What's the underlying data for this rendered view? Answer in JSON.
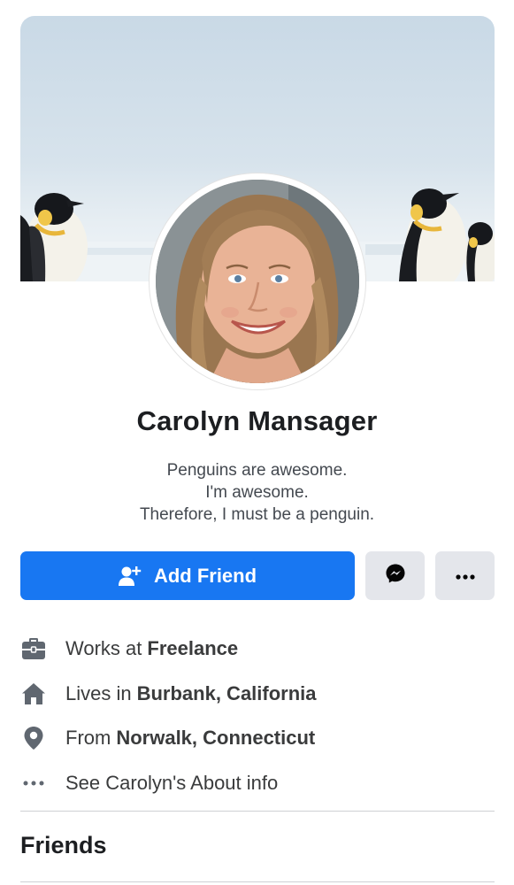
{
  "profile": {
    "name": "Carolyn Mansager",
    "bio": [
      "Penguins are awesome.",
      "I'm awesome.",
      "Therefore, I must be a penguin."
    ]
  },
  "actions": {
    "add_friend_label": "Add Friend",
    "add_friend_icon": "person-add-icon",
    "message_icon": "messenger-icon",
    "more_icon": "more-dots-icon",
    "primary_color": "#1877f2",
    "secondary_bg": "#e4e6eb"
  },
  "intro": [
    {
      "icon": "briefcase-icon",
      "prefix": "Works at",
      "value": "Freelance"
    },
    {
      "icon": "home-icon",
      "prefix": "Lives in",
      "value": "Burbank, California"
    },
    {
      "icon": "location-pin-icon",
      "prefix": "From",
      "value": "Norwalk, Connecticut"
    },
    {
      "icon": "more-dots-icon",
      "prefix": "See Carolyn's About info",
      "value": ""
    }
  ],
  "sections": {
    "friends_title": "Friends"
  }
}
